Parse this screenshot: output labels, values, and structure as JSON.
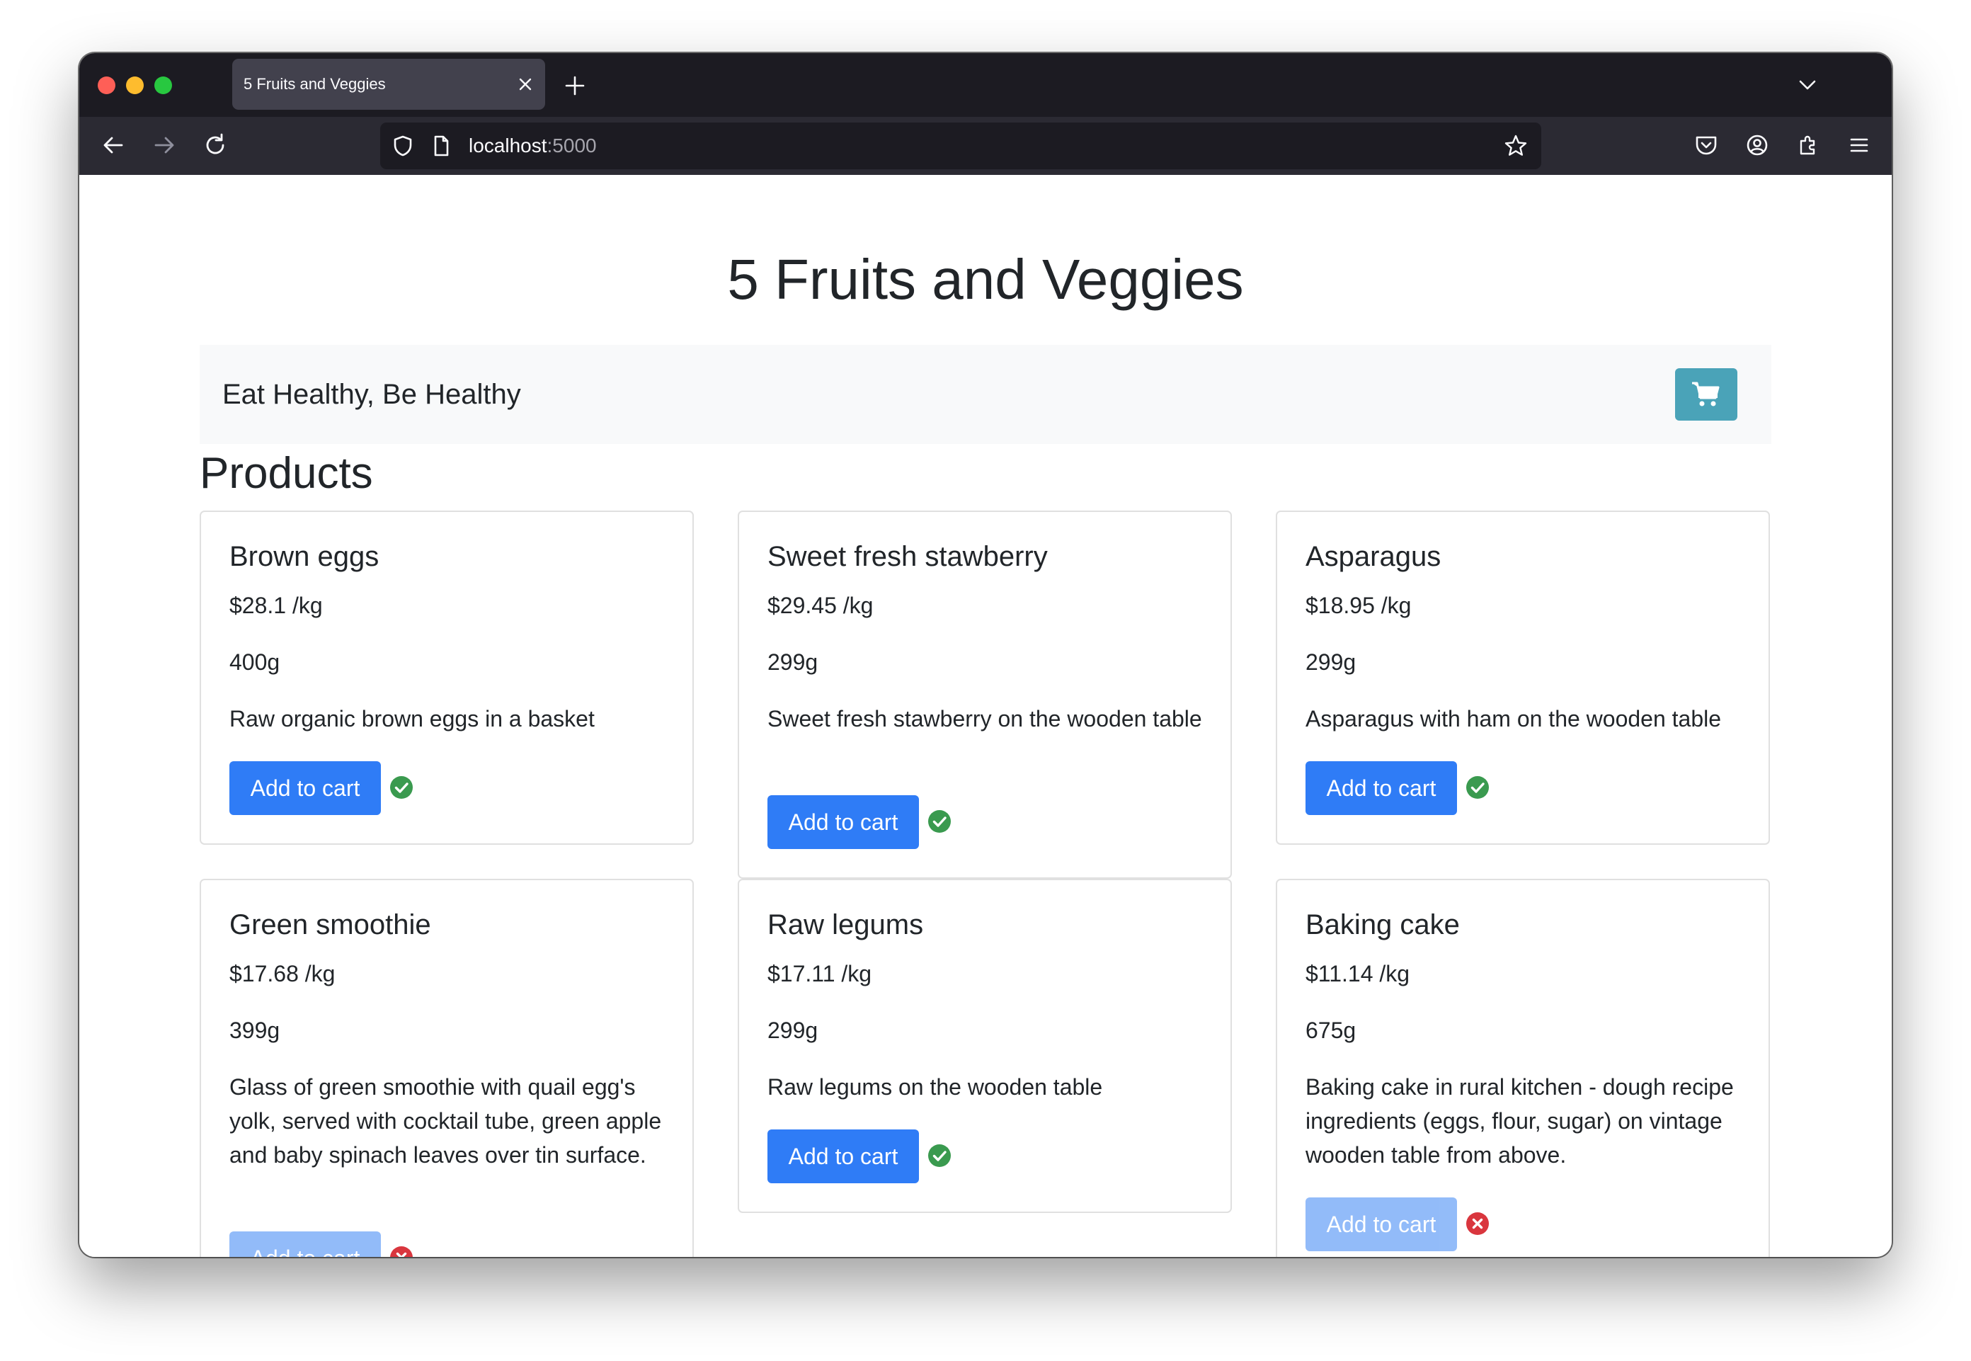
{
  "browser": {
    "tab_title": "5 Fruits and Veggies",
    "url_host": "localhost",
    "url_port": ":5000"
  },
  "page": {
    "title": "5 Fruits and Veggies",
    "brand": "Eat Healthy, Be Healthy",
    "section_title": "Products",
    "add_to_cart_label": "Add to cart"
  },
  "colors": {
    "add_button": "#2f7cf6",
    "cart_button": "#4aa3b8",
    "success": "#3a9a4f",
    "error": "#d9363e"
  },
  "products": [
    {
      "name": "Brown eggs",
      "price": "$28.1 /kg",
      "weight": "400g",
      "description": "Raw organic brown eggs in a basket",
      "status": "available",
      "status_icon": "check-circle-icon"
    },
    {
      "name": "Sweet fresh stawberry",
      "price": "$29.45 /kg",
      "weight": "299g",
      "description": "Sweet fresh stawberry on the wooden table",
      "status": "available",
      "status_icon": "check-circle-icon"
    },
    {
      "name": "Asparagus",
      "price": "$18.95 /kg",
      "weight": "299g",
      "description": "Asparagus with ham on the wooden table",
      "status": "available",
      "status_icon": "check-circle-icon"
    },
    {
      "name": "Green smoothie",
      "price": "$17.68 /kg",
      "weight": "399g",
      "description": "Glass of green smoothie with quail egg's yolk, served with cocktail tube, green apple and baby spinach leaves over tin surface.",
      "status": "unavailable",
      "status_icon": "x-circle-icon"
    },
    {
      "name": "Raw legums",
      "price": "$17.11 /kg",
      "weight": "299g",
      "description": "Raw legums on the wooden table",
      "status": "available",
      "status_icon": "check-circle-icon"
    },
    {
      "name": "Baking cake",
      "price": "$11.14 /kg",
      "weight": "675g",
      "description": "Baking cake in rural kitchen - dough recipe ingredients (eggs, flour, sugar) on vintage wooden table from above.",
      "status": "unavailable",
      "status_icon": "x-circle-icon"
    }
  ]
}
